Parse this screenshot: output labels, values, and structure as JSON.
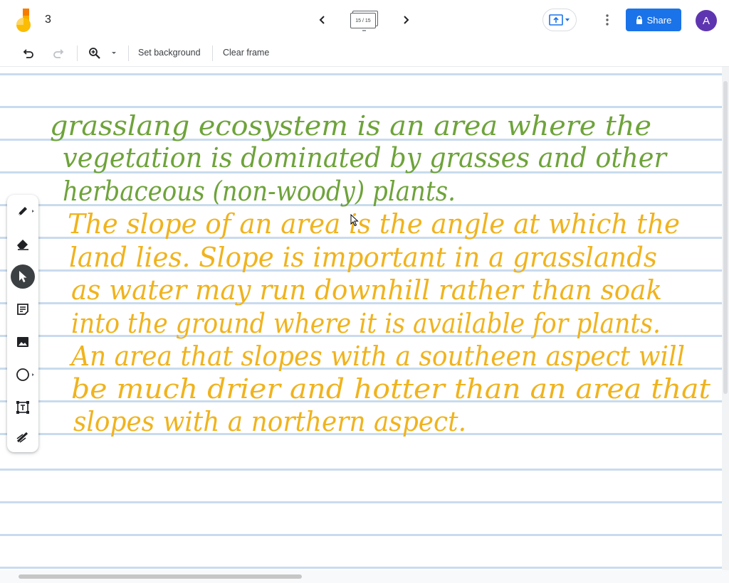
{
  "app": {
    "doc_title": "3",
    "frame_counter": "15 / 15",
    "share_label": "Share",
    "avatar_initial": "A",
    "colors": {
      "accent": "#1a73e8",
      "avatar": "#5e35b1",
      "green_ink": "#6ea33a",
      "yellow_ink": "#f0b31e",
      "ruled_line": "#c9dbee"
    }
  },
  "toolbar": {
    "undo_icon": "undo-icon",
    "redo_icon": "redo-icon",
    "zoom_icon": "zoom-in-icon",
    "set_background_label": "Set background",
    "clear_frame_label": "Clear frame"
  },
  "side_tools": [
    "pen-icon",
    "eraser-icon",
    "select-icon",
    "sticky-note-icon",
    "image-icon",
    "circle-icon",
    "text-box-icon",
    "laser-icon"
  ],
  "canvas": {
    "green_text": [
      "grasslang ecosystem is an area where the",
      "vegetation is dominated by grasses and other",
      "herbaceous (non-woody) plants."
    ],
    "yellow_text": [
      "The slope of an area is the angle at which the",
      "land lies. Slope is important in a grasslands",
      "as water may run downhill rather than soak",
      "into the ground where it is available for plants.",
      "An area that slopes with a southeen aspect will",
      "be much drier and hotter than an area that",
      "slopes with a northern aspect."
    ]
  }
}
